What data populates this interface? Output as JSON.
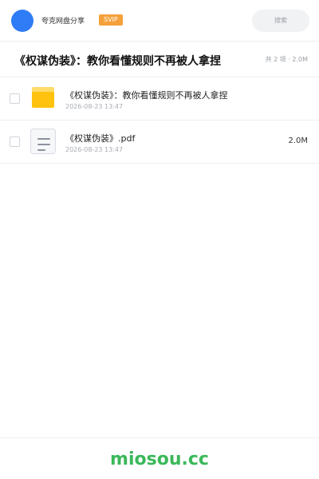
{
  "header": {
    "user_name": "夸克网盘分享",
    "badge": "SVIP",
    "search_placeholder": "搜索"
  },
  "title_bar": {
    "title": "《权谋伪装》：教你看懂规则不再被人拿捏",
    "summary": "共 2 项 · 2.0M"
  },
  "files": [
    {
      "type": "folder",
      "icon": "folder-icon",
      "name": "《权谋伪装》：教你看懂规则不再被人拿捏",
      "date": "2026-08-23 13:47",
      "size": ""
    },
    {
      "type": "file",
      "icon": "document-icon",
      "name": "《权谋伪装》.pdf",
      "date": "2026-08-23 13:47",
      "size": "2.0M"
    }
  ],
  "footer": {
    "brand": "miosou.cc"
  },
  "colors": {
    "accent": "#2f7cf6",
    "badge": "#f5a03a",
    "folder": "#ffc20e",
    "brand": "#3bb85a"
  }
}
